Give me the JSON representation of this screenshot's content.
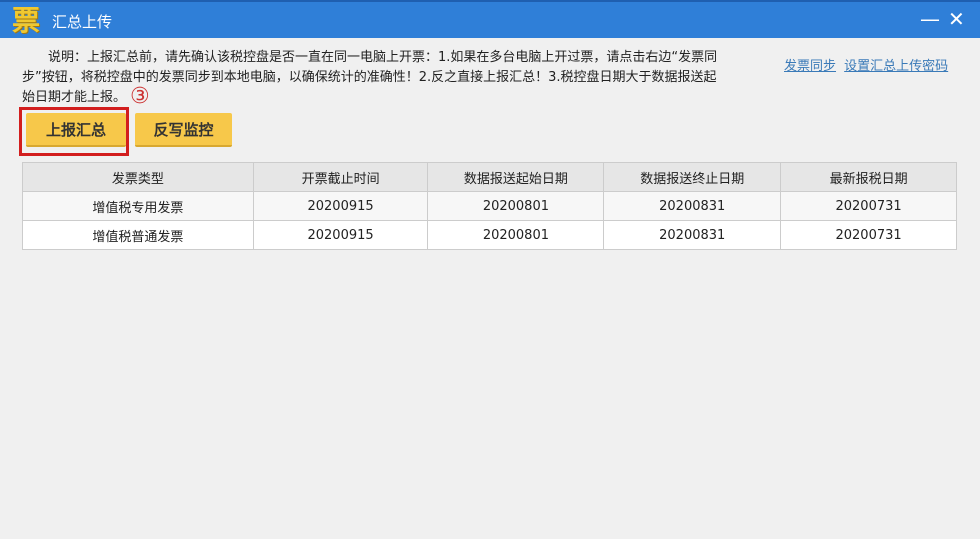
{
  "window": {
    "logo": "票",
    "title": "汇总上传",
    "minimize": "—",
    "close": "✕"
  },
  "description": {
    "lines": [
      "　　说明：上报汇总前，请先确认该税控盘是否一直在同一电脑上开票：1.如果在多台电脑上开过票，请点击右边“发票同",
      "步”按钮，将税控盘中的发票同步到本地电脑，以确保统计的准确性！2.反之直接上报汇总！3.税控盘日期大于数据报送起",
      "始日期才能上报。"
    ]
  },
  "links": {
    "sync": "发票同步",
    "set_password": "设置汇总上传密码"
  },
  "annotation": "③",
  "buttons": {
    "report": "上报汇总",
    "writeback": "反写监控"
  },
  "table": {
    "headers": [
      "发票类型",
      "开票截止时间",
      "数据报送起始日期",
      "数据报送终止日期",
      "最新报税日期"
    ],
    "rows": [
      [
        "增值税专用发票",
        "20200915",
        "20200801",
        "20200831",
        "20200731"
      ],
      [
        "增值税普通发票",
        "20200915",
        "20200801",
        "20200831",
        "20200731"
      ]
    ]
  }
}
